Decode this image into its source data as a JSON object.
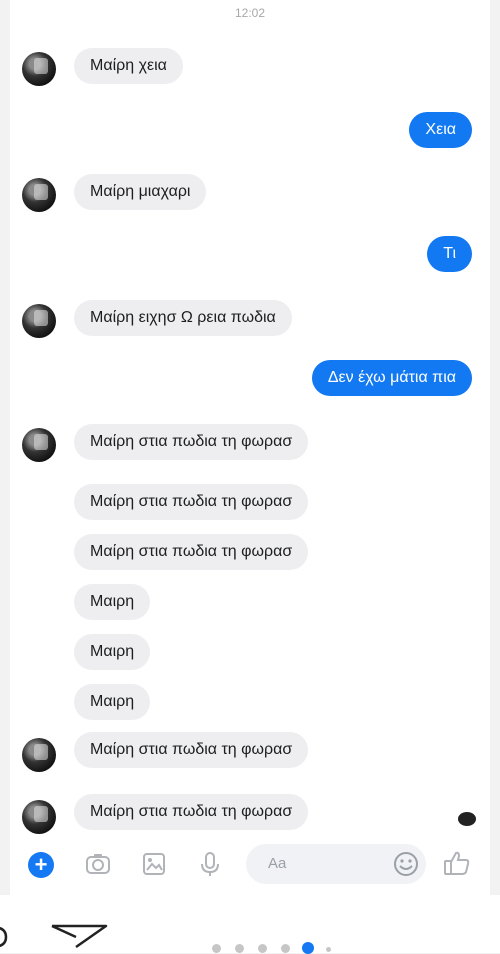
{
  "status": {
    "time": "12:02"
  },
  "messages": [
    {
      "dir": "in",
      "text": "Μαίρη χεια"
    },
    {
      "dir": "out",
      "text": "Χεια"
    },
    {
      "dir": "in",
      "text": "Μαίρη μιαχαρι"
    },
    {
      "dir": "out",
      "text": "Τι"
    },
    {
      "dir": "in",
      "text": "Μαίρη ειχησ Ω ρεια πωδια"
    },
    {
      "dir": "out",
      "text": "Δεν έχω μάτια πια"
    },
    {
      "dir": "in",
      "text": "Μαίρη στια πωδια τη φωρασ"
    },
    {
      "dir": "in",
      "text": "Μαίρη στια πωδια τη φωρασ"
    },
    {
      "dir": "in",
      "text": "Μαίρη στια πωδια τη φωρασ"
    },
    {
      "dir": "in",
      "text": "Μαιρη"
    },
    {
      "dir": "in",
      "text": "Μαιρη"
    },
    {
      "dir": "in",
      "text": "Μαιρη"
    },
    {
      "dir": "in",
      "text": "Μαίρη στια πωδια τη φωρασ"
    },
    {
      "dir": "in",
      "text": "Μαίρη στια πωδια τη φωρασ"
    }
  ],
  "composer": {
    "placeholder": "Aa",
    "icons": [
      "plus-icon",
      "camera-icon",
      "gallery-icon",
      "microphone-icon",
      "emoji-icon",
      "thumbs-up-icon"
    ]
  },
  "footer": {
    "icons": [
      "comment-icon",
      "share-icon"
    ],
    "carousel_pages": 6,
    "carousel_active_index": 4
  },
  "colors": {
    "outgoing_bubble": "#1279f2",
    "incoming_bubble": "#eeeef0",
    "accent": "#1479f2"
  }
}
